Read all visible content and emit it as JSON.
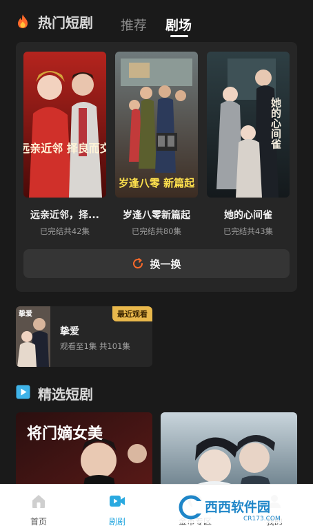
{
  "header": {
    "section_title": "热门短剧",
    "tabs": [
      {
        "label": "推荐",
        "active": false
      },
      {
        "label": "剧场",
        "active": true
      }
    ]
  },
  "theater": {
    "items": [
      {
        "title": "远亲近邻，择...",
        "status": "已完结共42集",
        "poster_text": "远亲近邻 择良而交"
      },
      {
        "title": "岁逢八零新篇起",
        "status": "已完结共80集",
        "poster_text": "岁逢八零 新篇起"
      },
      {
        "title": "她的心间雀",
        "status": "已完结共43集",
        "poster_text": "她的心间雀"
      }
    ],
    "swap_button": "换一换"
  },
  "recent": {
    "badge": "最近观看",
    "title": "挚爱",
    "progress": "观看至1集 共101集",
    "thumb_text": "挚爱"
  },
  "selected": {
    "section_title": "精选短剧",
    "cards": [
      {
        "poster_text": "将门嫡女美",
        "tone": "dark-red"
      },
      {
        "poster_text": "",
        "tone": "blue-grey"
      }
    ]
  },
  "navbar": {
    "items": [
      {
        "label": "首页",
        "icon": "home-icon",
        "active": false
      },
      {
        "label": "剧剧",
        "icon": "video-icon",
        "active": true
      },
      {
        "label": "金币专区",
        "icon": "coin-icon",
        "active": false
      },
      {
        "label": "我的",
        "icon": "user-icon",
        "active": false
      }
    ]
  },
  "watermark": {
    "text": "西西软件园",
    "url": "CR173.COM"
  },
  "colors": {
    "accent_blue": "#2aa9e0",
    "badge_gold": "#e9b84c",
    "refresh_orange": "#ff6a2a"
  }
}
